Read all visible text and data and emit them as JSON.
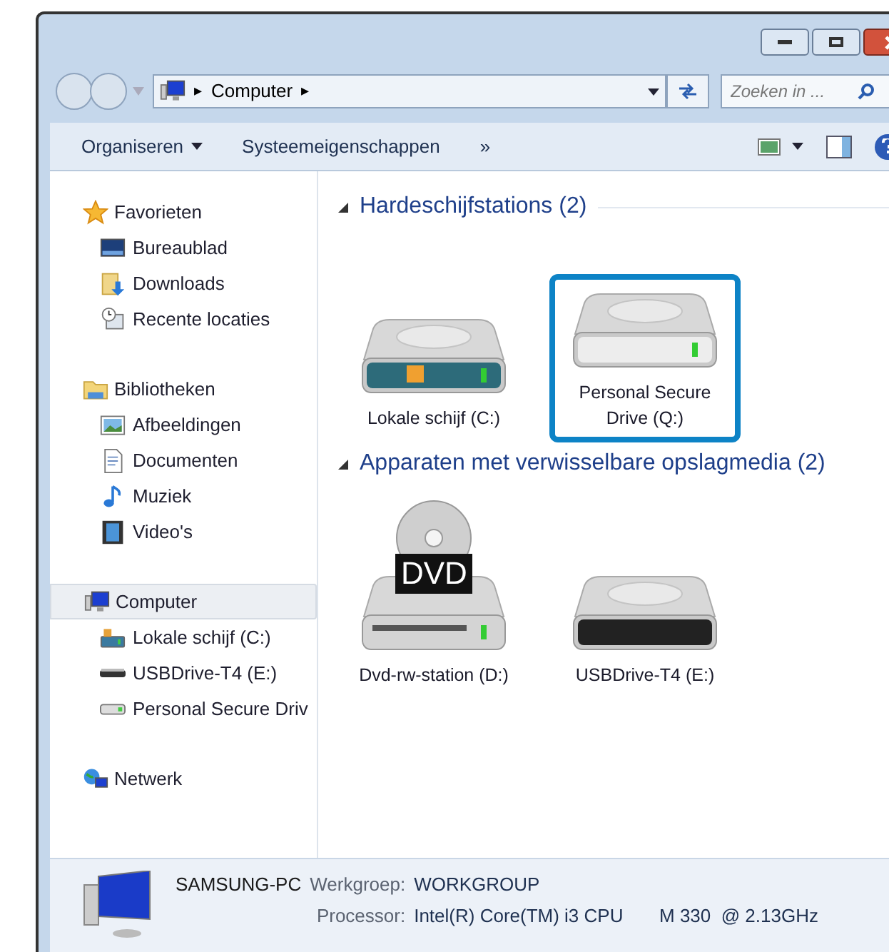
{
  "address_bar": {
    "crumbs": [
      "Computer"
    ],
    "separator": "▸"
  },
  "search": {
    "placeholder": "Zoeken in ..."
  },
  "toolbar": {
    "items": [
      {
        "label": "Organiseren",
        "kind": "dropdown"
      },
      {
        "label": "Systeemeigenschappen",
        "kind": "plain"
      },
      {
        "label": "»",
        "kind": "plain"
      }
    ]
  },
  "sidebar": {
    "groups": [
      {
        "label": "Favorieten",
        "kind": "star",
        "selected": false,
        "children": [
          {
            "label": "Bureaublad",
            "kind": "desktop",
            "selected": false
          },
          {
            "label": "Downloads",
            "kind": "downloads",
            "selected": false
          },
          {
            "label": "Recente locaties",
            "kind": "recent",
            "selected": false
          }
        ]
      },
      {
        "label": "Bibliotheken",
        "kind": "library",
        "selected": false,
        "children": [
          {
            "label": "Afbeeldingen",
            "kind": "pictures",
            "selected": false
          },
          {
            "label": "Documenten",
            "kind": "documents",
            "selected": false
          },
          {
            "label": "Muziek",
            "kind": "music",
            "selected": false
          },
          {
            "label": "Video's",
            "kind": "videos",
            "selected": false
          }
        ]
      },
      {
        "label": "Computer",
        "kind": "computer",
        "selected": true,
        "children": [
          {
            "label": "Lokale schijf (C:)",
            "kind": "windows-disk",
            "selected": false
          },
          {
            "label": "USBDrive-T4 (E:)",
            "kind": "usb",
            "selected": false
          },
          {
            "label": "Personal Secure Driv",
            "kind": "disk",
            "selected": false
          }
        ]
      },
      {
        "label": "Netwerk",
        "kind": "network",
        "selected": false
      }
    ]
  },
  "content": {
    "groups": [
      {
        "title": "Hardeschijfstations (2)",
        "expanded": true,
        "items": [
          {
            "label": "Lokale schijf (C:)",
            "kind": "windows-disk",
            "selected": false
          },
          {
            "label": "Personal Secure Drive (Q:)",
            "kind": "disk",
            "selected": true
          }
        ]
      },
      {
        "title": "Apparaten met verwisselbare opslagmedia (2)",
        "expanded": true,
        "items": [
          {
            "label": "Dvd-rw-station (D:)",
            "kind": "dvd",
            "badge": "DVD",
            "selected": false
          },
          {
            "label": "USBDrive-T4 (E:)",
            "kind": "usb",
            "selected": false
          }
        ]
      }
    ]
  },
  "details": {
    "name": "SAMSUNG-PC",
    "fields": [
      {
        "label": "Werkgroep:",
        "value": "WORKGROUP"
      },
      {
        "label": "Processor:",
        "value": "Intel(R) Core(TM) i3 CPU       M 330  @ 2.13GHz"
      }
    ]
  }
}
